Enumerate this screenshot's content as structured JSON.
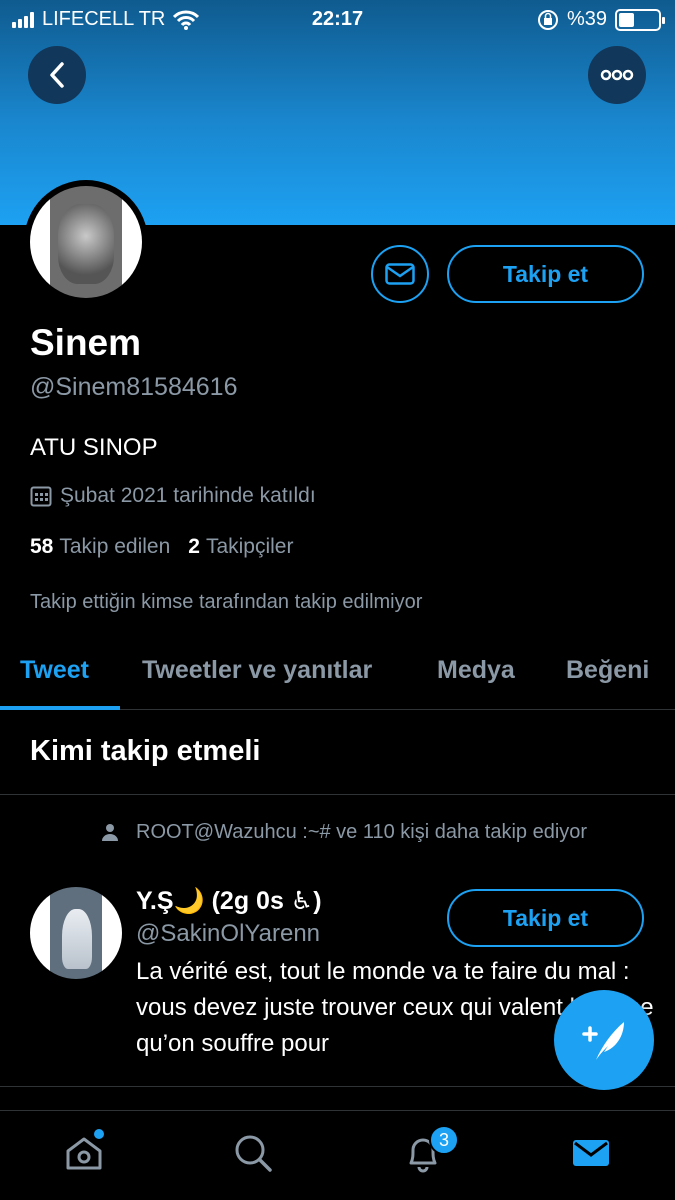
{
  "status_bar": {
    "carrier": "LIFECELL TR",
    "time": "22:17",
    "battery": "%39",
    "battery_level": 0.39
  },
  "header": {
    "back_icon": "back-arrow-icon",
    "more_icon": "more-options-icon"
  },
  "profile": {
    "name": "Sinem",
    "handle": "@Sinem81584616",
    "bio": "ATU SINOP",
    "joined": "Şubat 2021 tarihinde katıldı",
    "following_count": "58",
    "following_label": "Takip edilen",
    "followers_count": "2",
    "followers_label": "Takipçiler",
    "not_followed_note": "Takip ettiğin kimse tarafından takip edilmiyor",
    "follow_label": "Takip et"
  },
  "tabs": [
    {
      "label": "Tweet",
      "active": true
    },
    {
      "label": "Tweetler ve yanıtlar",
      "active": false
    },
    {
      "label": "Medya",
      "active": false
    },
    {
      "label": "Beğeni",
      "active": false
    }
  ],
  "suggestions": {
    "title": "Kimi takip etmeli",
    "items": [
      {
        "social_context": "ROOT@Wazuhcu :~# ve 110 kişi daha takip ediyor",
        "name": "Y.Ş🌙 (2g 0s ♿)",
        "handle": "@SakinOlYarenn",
        "bio": "La vérité est, tout le monde va te faire du mal : vous devez juste trouver ceux qui valent la peine qu’on souffre pour",
        "follow_label": "Takip et"
      }
    ]
  },
  "bottom_nav": {
    "items": [
      "home-icon",
      "search-icon",
      "notifications-icon",
      "messages-icon"
    ],
    "notifications_badge": "3"
  },
  "colors": {
    "accent": "#1da1f2",
    "background": "#000000",
    "secondary_text": "#8b98a5"
  }
}
